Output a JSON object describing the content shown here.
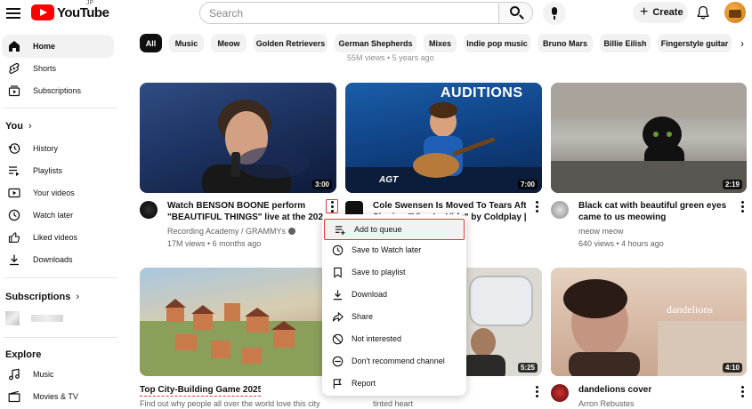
{
  "header": {
    "logo_text": "YouTube",
    "logo_region": "JP",
    "search_placeholder": "Search",
    "create_label": "Create"
  },
  "sidebar": {
    "top": [
      {
        "label": "Home",
        "icon": "home-icon"
      },
      {
        "label": "Shorts",
        "icon": "shorts-icon"
      },
      {
        "label": "Subscriptions",
        "icon": "subscriptions-icon"
      }
    ],
    "you_heading": "You",
    "you_items": [
      {
        "label": "History",
        "icon": "history-icon"
      },
      {
        "label": "Playlists",
        "icon": "playlists-icon"
      },
      {
        "label": "Your videos",
        "icon": "your-videos-icon"
      },
      {
        "label": "Watch later",
        "icon": "watch-later-icon"
      },
      {
        "label": "Liked videos",
        "icon": "liked-videos-icon"
      },
      {
        "label": "Downloads",
        "icon": "downloads-icon"
      }
    ],
    "subscriptions_heading": "Subscriptions",
    "explore_heading": "Explore",
    "explore_items": [
      {
        "label": "Music",
        "icon": "music-icon"
      },
      {
        "label": "Movies & TV",
        "icon": "movies-icon"
      }
    ]
  },
  "chips": [
    "All",
    "Music",
    "Meow",
    "Golden Retrievers",
    "German Shepherds",
    "Mixes",
    "Indie pop music",
    "Bruno Mars",
    "Billie Eilish",
    "Fingerstyle guitar"
  ],
  "ghost_meta": "55M views • 5 years ago",
  "videos": [
    {
      "title_line1": "Watch BENSON BOONE perform",
      "title_line2": "\"BEAUTIFUL THINGS\" live at the 202...",
      "channel": "Recording Academy / GRAMMYs",
      "meta": "17M views • 6 months ago",
      "duration": "3:00"
    },
    {
      "title_line1": "Cole Swensen Is Moved To Tears After",
      "title_line2": "Singing \"Viva La Vida\" by Coldplay |",
      "channel": "",
      "meta": "",
      "duration": "7:00",
      "overlay_text": "AUDITIONS",
      "badge_text": "AGT"
    },
    {
      "title_line1": "Black cat with beautiful green eyes",
      "title_line2": "came to us meowing",
      "channel": "meow meow",
      "meta": "640 views • 4 hours ago",
      "duration": "2:19"
    },
    {
      "title_line1": "Top City-Building Game 2025",
      "title_line2": "",
      "channel": "Find out why people all over the world love this city-",
      "meta": "",
      "duration": ""
    },
    {
      "title_line1": "",
      "title_line2": "",
      "channel": "tinted heart",
      "meta": "",
      "duration": "5:25"
    },
    {
      "title_line1": "dandelions cover",
      "title_line2": "",
      "channel": "Arron Rebustes",
      "meta": "",
      "duration": "4:10",
      "overlay_text": "dandelions"
    }
  ],
  "menu": [
    {
      "label": "Add to queue",
      "icon": "add-to-queue-icon"
    },
    {
      "label": "Save to Watch later",
      "icon": "clock-icon"
    },
    {
      "label": "Save to playlist",
      "icon": "save-playlist-icon"
    },
    {
      "label": "Download",
      "icon": "download-icon"
    },
    {
      "label": "Share",
      "icon": "share-icon"
    },
    {
      "label": "Not interested",
      "icon": "not-interested-icon"
    },
    {
      "label": "Don't recommend channel",
      "icon": "dont-recommend-icon"
    },
    {
      "label": "Report",
      "icon": "flag-icon"
    }
  ],
  "colors": {
    "brand": "#ff0000",
    "highlight": "#e53935"
  }
}
